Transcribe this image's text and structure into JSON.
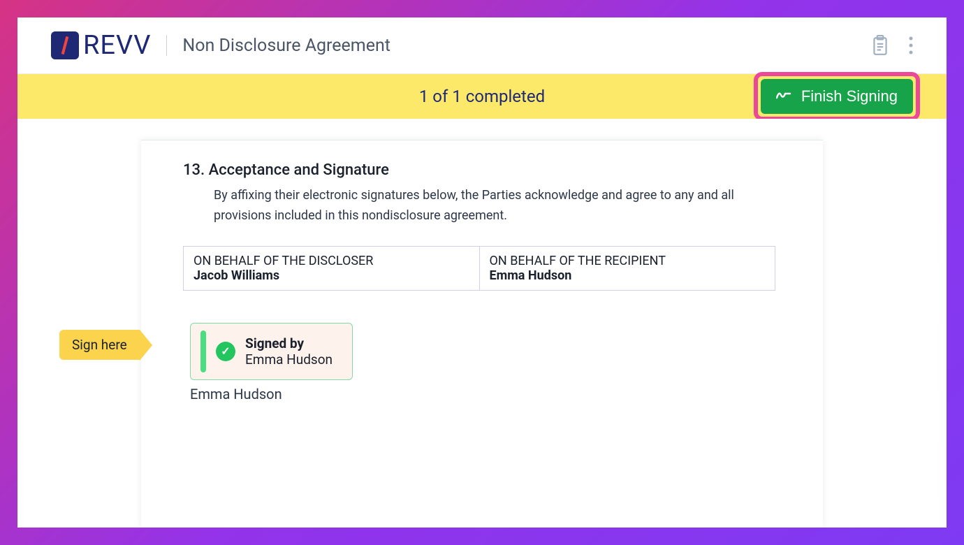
{
  "brand": {
    "name": "REVV"
  },
  "header": {
    "docTitle": "Non Disclosure Agreement"
  },
  "statusBar": {
    "text": "1 of 1 completed",
    "finishLabel": "Finish Signing"
  },
  "document": {
    "sectionNumber": "13.",
    "sectionTitle": "Acceptance and Signature",
    "sectionBody": "By affixing their electronic signatures below, the Parties acknowledge and agree to any and all provisions included in this nondisclosure agreement.",
    "parties": {
      "discloser": {
        "label": "ON BEHALF OF THE DISCLOSER",
        "name": "Jacob Williams"
      },
      "recipient": {
        "label": "ON BEHALF OF THE RECIPIENT",
        "name": "Emma Hudson"
      }
    },
    "signHereLabel": "Sign here",
    "signedBox": {
      "label": "Signed by",
      "name": "Emma Hudson"
    },
    "signerCaption": "Emma Hudson"
  }
}
